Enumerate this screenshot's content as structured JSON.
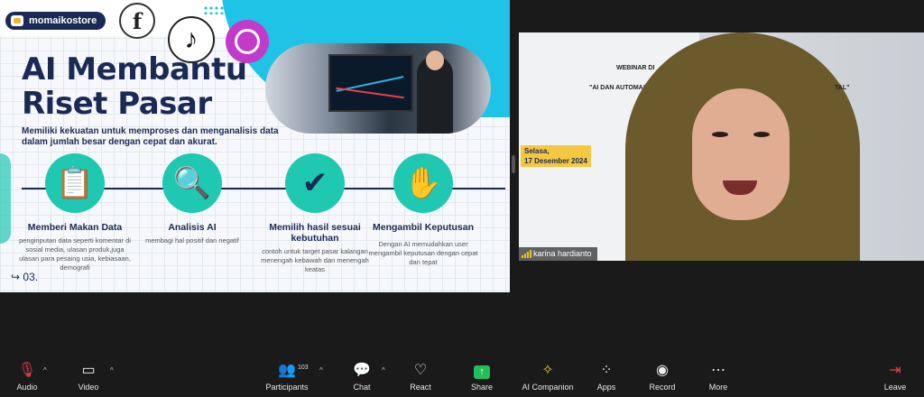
{
  "slide": {
    "brand": "momaikostore",
    "title_line1": "AI Membantu",
    "title_line2": "Riset Pasar",
    "subtitle": "Memiliki kekuatan untuk memproses dan menganalisis data dalam jumlah besar dengan cepat dan akurat.",
    "page_number": "03.",
    "steps": [
      {
        "title": "Memberi Makan Data",
        "desc": "penginputan data seperti komentar di sosial media, ulasan produk,juga ulasan para pesaing usia, kebiasaan, demografi",
        "icon": "clipboard-chart-icon"
      },
      {
        "title": "Analisis AI",
        "desc": "membagi hal positif dan negatif",
        "icon": "magnifier-chart-icon"
      },
      {
        "title": "Memilih hasil sesuai kebutuhan",
        "desc": "contoh untuk target pasar kalangan menengah kebawah dan menengah keatas",
        "icon": "document-check-icon"
      },
      {
        "title": "Mengambil Keputusan",
        "desc": "Dengan AI memudahkan user mengambil keputusan dengan cepat dan tepat",
        "icon": "decision-hand-icon"
      }
    ]
  },
  "video": {
    "participant_name": "karina hardianto",
    "poster_line1": "WEBINAR DI",
    "poster_line2": "\"AI DAN AUTOMAS",
    "poster_line3": "TAL\"",
    "date_line1": "Selasa,",
    "date_line2": "17 Desember 2024"
  },
  "toolbar": {
    "audio": "Audio",
    "video": "Video",
    "participants": "Participants",
    "participants_count": "103",
    "chat": "Chat",
    "react": "React",
    "share": "Share",
    "ai_companion": "AI Companion",
    "apps": "Apps",
    "record": "Record",
    "more": "More",
    "leave": "Leave"
  },
  "colors": {
    "brand_navy": "#1b2a55",
    "accent_cyan": "#1fc3e6",
    "accent_teal": "#1fc8b0",
    "share_green": "#1fbf5a",
    "muted_red": "#e5414a"
  }
}
